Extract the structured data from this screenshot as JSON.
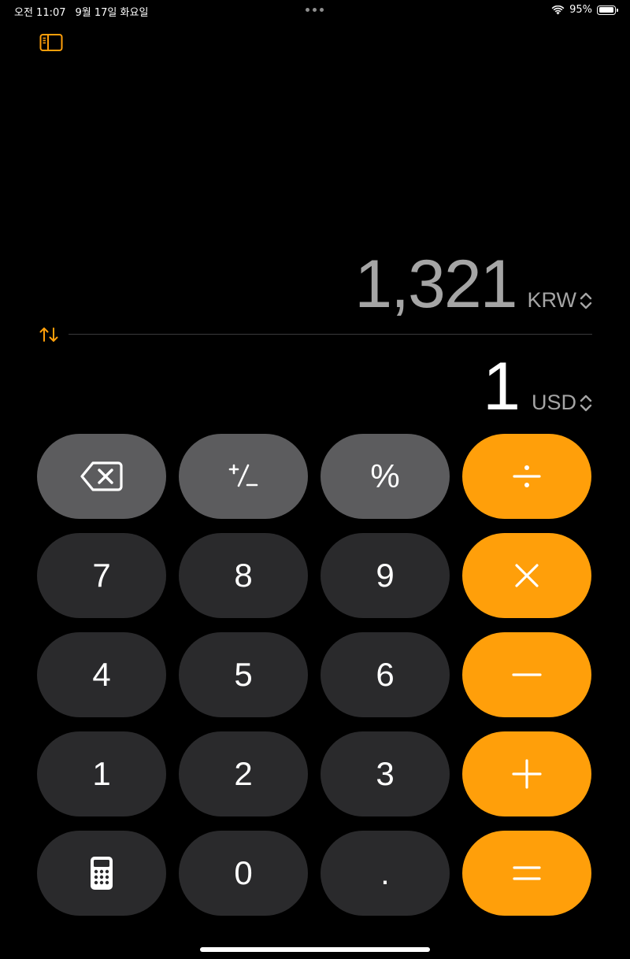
{
  "status": {
    "time": "오전 11:07",
    "date": "9월 17일 화요일",
    "battery": "95%",
    "battery_level": 0.95
  },
  "display": {
    "converted_value": "1,321",
    "converted_currency": "KRW",
    "input_value": "1",
    "input_currency": "USD"
  },
  "keys": {
    "percent": "%",
    "seven": "7",
    "eight": "8",
    "nine": "9",
    "four": "4",
    "five": "5",
    "six": "6",
    "one": "1",
    "two": "2",
    "three": "3",
    "zero": "0",
    "decimal": "."
  },
  "colors": {
    "accent": "#ff9f0a",
    "function_key": "#5c5c5e",
    "number_key": "#2a2a2c",
    "background": "#000000"
  }
}
